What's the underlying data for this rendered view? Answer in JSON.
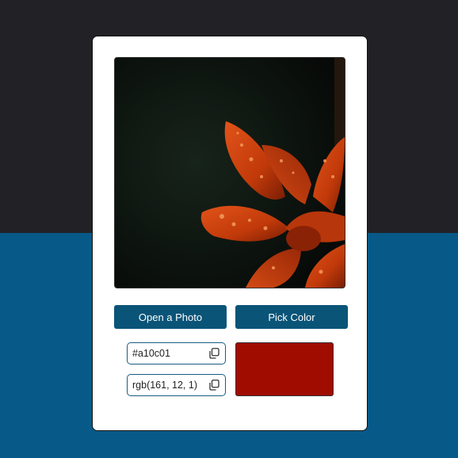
{
  "photo": {
    "alt": "Orange lily with water droplets on dark green background"
  },
  "buttons": {
    "open_label": "Open a Photo",
    "pick_label": "Pick Color"
  },
  "color": {
    "hex": "#a10c01",
    "rgb": "rgb(161, 12, 1)",
    "swatch": "#a10c01"
  },
  "icons": {
    "copy_hex": "copy-icon",
    "copy_rgb": "copy-icon"
  },
  "theme": {
    "top_background": "#222226",
    "bottom_background": "#075a87",
    "button_background": "#0a5478",
    "card_background": "#ffffff"
  }
}
